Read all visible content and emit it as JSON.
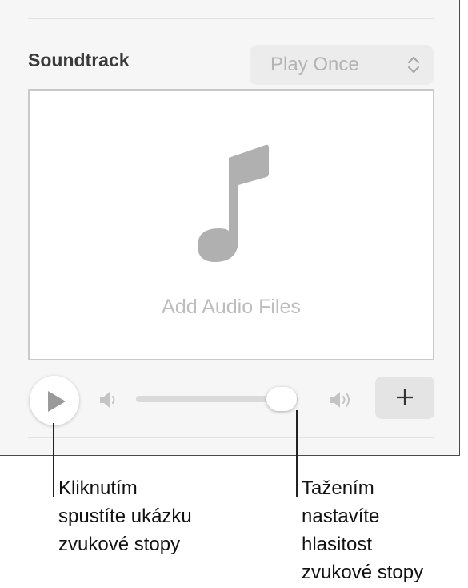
{
  "soundtrack": {
    "title": "Soundtrack",
    "playback_mode": {
      "selected": "Play Once"
    },
    "drop_area": {
      "label": "Add Audio Files"
    },
    "controls": {
      "play_icon": "play-icon",
      "volume_low_icon": "speaker-low-icon",
      "volume_high_icon": "speaker-high-icon",
      "add_icon": "plus-icon",
      "volume_level": 0.9
    }
  },
  "callouts": {
    "play": [
      "Kliknutím",
      "spustíte ukázku",
      "zvukové stopy"
    ],
    "volume": [
      "Tažením",
      "nastavíte",
      "hlasitost",
      "zvukové stopy"
    ]
  },
  "colors": {
    "panel_background": "#f6f6f6",
    "muted_text": "#b3b3b3",
    "icon_gray": "#b0b0b0"
  }
}
